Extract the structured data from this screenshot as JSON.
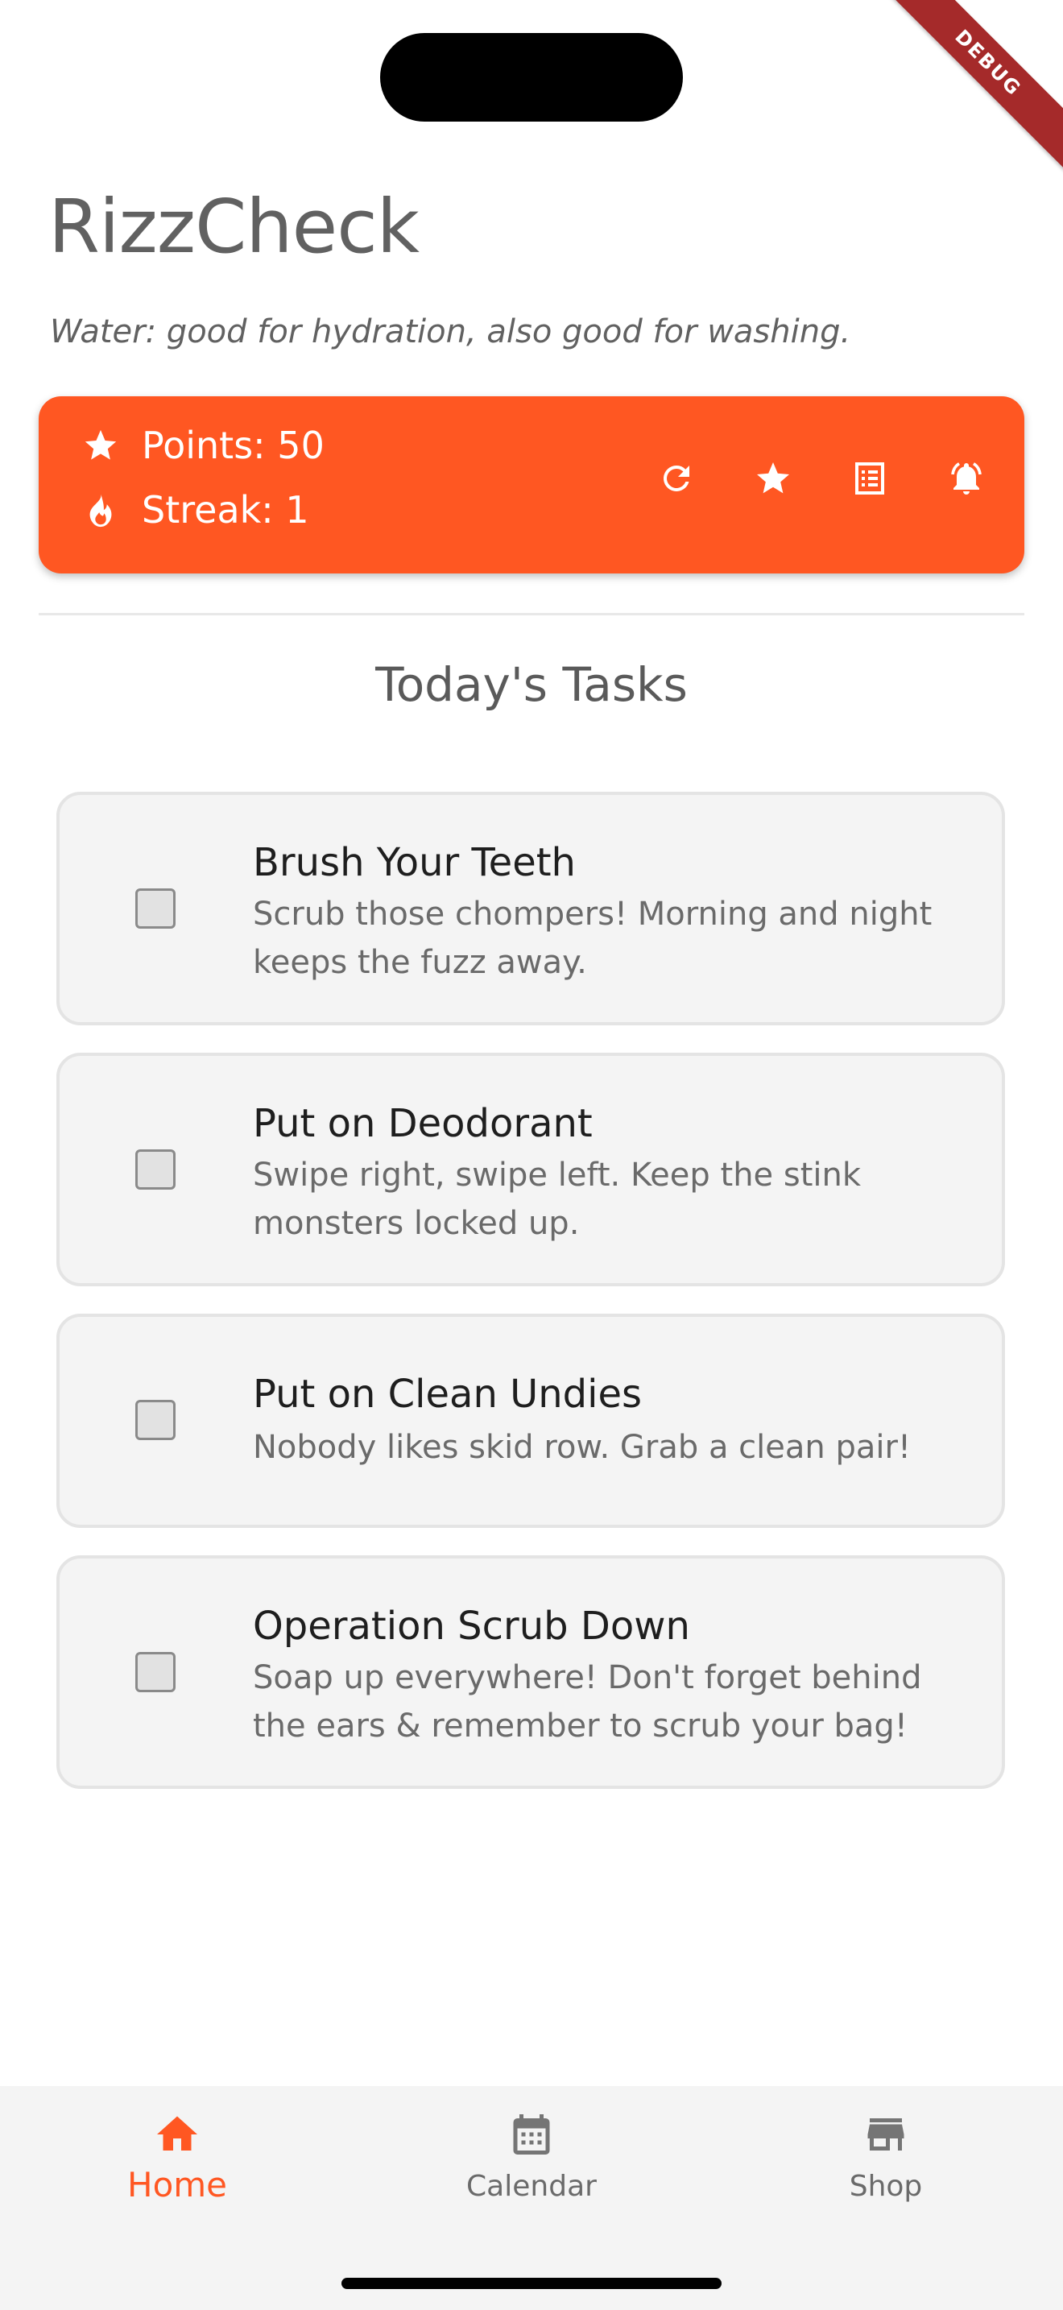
{
  "debug_banner": {
    "label": "DEBUG"
  },
  "header": {
    "title": "RizzCheck",
    "subtitle": "Water: good for hydration, also good for washing."
  },
  "stats": {
    "points_label": "Points: 50",
    "streak_label": "Streak: 1",
    "accent_color": "#FF5722",
    "actions": [
      "refresh-icon",
      "star-icon",
      "list-icon",
      "alarm-icon"
    ]
  },
  "tasks_section": {
    "heading": "Today's Tasks",
    "items": [
      {
        "title": "Brush Your Teeth",
        "description": "Scrub those chompers! Morning and night keeps the fuzz away.",
        "checked": false
      },
      {
        "title": "Put on Deodorant",
        "description": "Swipe right, swipe left. Keep the stink monsters locked up.",
        "checked": false
      },
      {
        "title": "Put on Clean Undies",
        "description": "Nobody likes skid row. Grab a clean pair!",
        "checked": false
      },
      {
        "title": "Operation Scrub Down",
        "description": "Soap up everywhere! Don't forget behind the ears & remember to scrub your bag!",
        "checked": false
      }
    ]
  },
  "bottom_nav": {
    "items": [
      {
        "label": "Home",
        "icon": "home-icon",
        "active": true
      },
      {
        "label": "Calendar",
        "icon": "calendar-icon",
        "active": false
      },
      {
        "label": "Shop",
        "icon": "store-icon",
        "active": false
      }
    ],
    "active_color": "#FF5722",
    "inactive_color": "#6A6A6A"
  }
}
